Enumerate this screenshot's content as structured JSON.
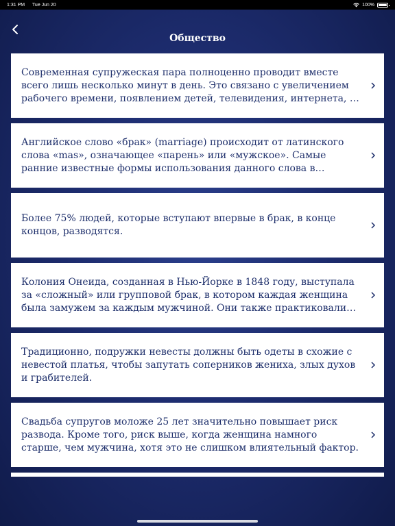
{
  "status_bar": {
    "time": "1:31 PM",
    "date": "Tue Jun 20",
    "battery": "100%",
    "icons": [
      "wifi-icon",
      "battery-icon"
    ]
  },
  "nav": {
    "title": "Общество",
    "back_icon": "chevron-left-icon"
  },
  "colors": {
    "background": "#1d2c6e",
    "card": "#ffffff",
    "text": "#1e2f6b"
  },
  "items": [
    {
      "text": "Современная супружеская пара полноценно проводит вместе всего лишь несколько минут в  день. Это связано с увеличением рабочего времени, появлением детей,  телевидения, интернета, и т.д."
    },
    {
      "text": "Английское слово «брак» (marriage) происходит от латинского слова «mas», означающее «парень» или «мужское». Самые ранние известные формы использования данного слова в английском языке"
    },
    {
      "text": "Более 75% людей, которые вступают впервые в брак, в конце концов, разводятся."
    },
    {
      "text": "Колония Онеида, созданная в Нью-Йорке в 1848 году, выступала за «сложный» или групповой брак, в котором каждая женщина была замужем за каждым мужчиной. Они также практиковали «мужское воздержание»"
    },
    {
      "text": "Традиционно, подружки невесты должны быть одеты в схожие с невестой платья, чтобы запутать соперников жениха, злых духов и грабителей."
    },
    {
      "text": "Свадьба супругов моложе 25 лет значительно повышает риск развода. Кроме того, риск выше, когда женщина намного старше, чем мужчина, хотя это не слишком влиятельный фактор."
    }
  ]
}
